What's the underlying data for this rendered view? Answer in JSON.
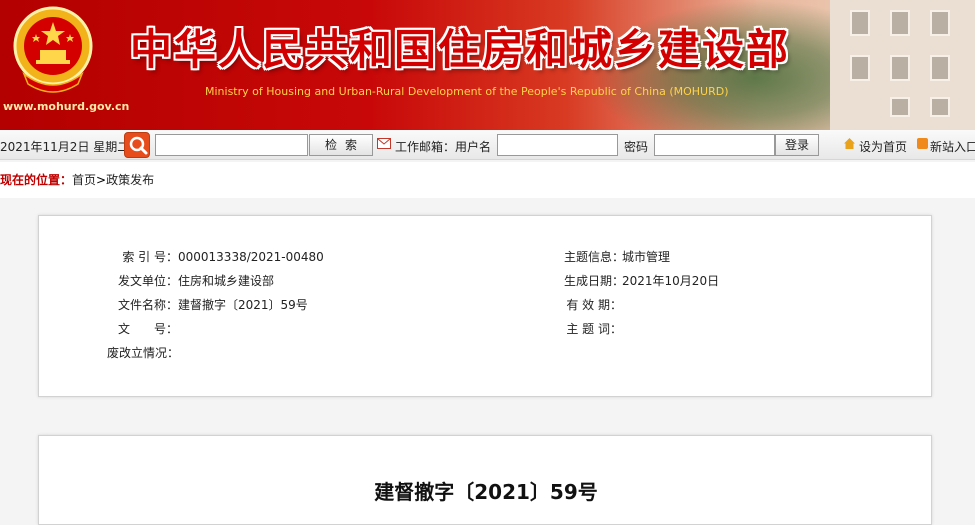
{
  "banner": {
    "site_url": "www.mohurd.gov.cn",
    "title": "中华人民共和国住房和城乡建设部",
    "subtitle": "Ministry of Housing and Urban-Rural Development of the People's Republic of China (MOHURD)",
    "title_color": "#d20000",
    "subtitle_color": "#ffd24a"
  },
  "toolbar": {
    "date": "2021年11月2日 星期二",
    "search_icon": "search-icon",
    "search_placeholder": "",
    "search_button": "检索",
    "mail_icon": "mail-icon",
    "mail_label": "工作邮箱：用户名",
    "username_value": "",
    "password_label": "密码",
    "password_value": "",
    "login_button": "登录",
    "home_icon": "home-icon",
    "set_home": "设为首页",
    "rss_icon": "rss-icon",
    "site_entry": "新站入口"
  },
  "breadcrumb": {
    "label": "现在的位置：",
    "home": "首页",
    "separator": ">",
    "current": "政策发布"
  },
  "info": {
    "index_label": "索 引 号：",
    "index_value": "000013338/2021-00480",
    "issuer_label": "发文单位：",
    "issuer_value": "住房和城乡建设部",
    "docname_label": "文件名称：",
    "docname_value": "建督撤字〔2021〕59号",
    "docno_label": "文　　号：",
    "docno_value": "",
    "status_label": "废改立情况：",
    "status_value": "",
    "topic_label": "主题信息：",
    "topic_value": "城市管理",
    "date_label": "生成日期：",
    "date_value": "2021年10月20日",
    "valid_label": "有 效 期：",
    "valid_value": "",
    "keywords_label": "主 题 词：",
    "keywords_value": ""
  },
  "content": {
    "title": "建督撤字〔2021〕59号"
  }
}
